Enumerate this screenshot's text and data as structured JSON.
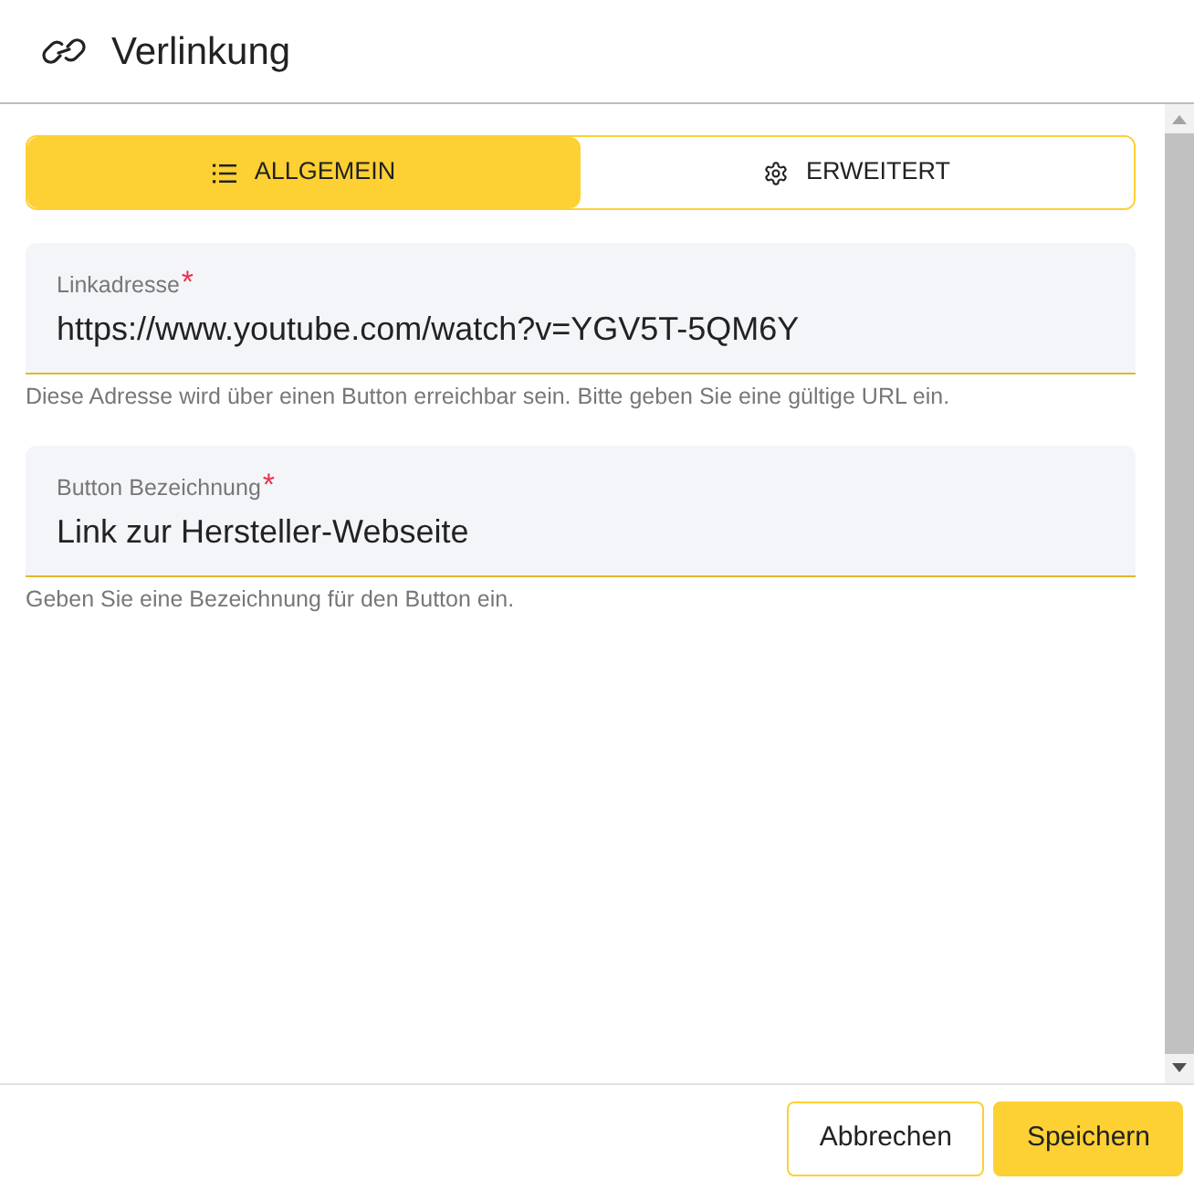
{
  "dialog": {
    "title": "Verlinkung"
  },
  "tabs": [
    {
      "label": "ALLGEMEIN",
      "selected": true
    },
    {
      "label": "ERWEITERT",
      "selected": false
    }
  ],
  "fields": [
    {
      "label": "Linkadresse",
      "required_mark": "*",
      "value": "https://www.youtube.com/watch?v=YGV5T-5QM6Y",
      "helper": "Diese Adresse wird über einen Button erreichbar sein. Bitte geben Sie eine gültige URL ein."
    },
    {
      "label": "Button Bezeichnung",
      "required_mark": "*",
      "value": "Link zur Hersteller-Webseite",
      "helper": "Geben Sie eine Bezeichnung für den Button ein."
    }
  ],
  "buttons": [
    {
      "label": "Abbrechen",
      "kind": "secondary"
    },
    {
      "label": "Speichern",
      "kind": "primary"
    }
  ]
}
